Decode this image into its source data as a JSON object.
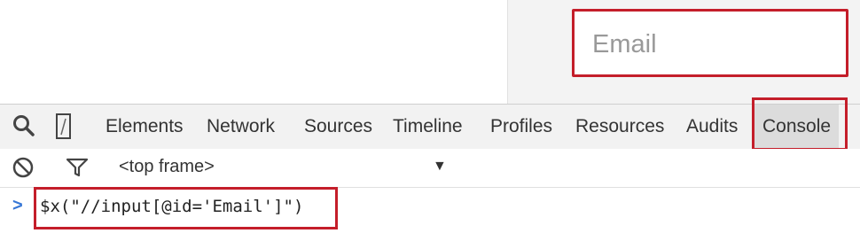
{
  "page": {
    "email_placeholder": "Email"
  },
  "devtools": {
    "toolbar": {
      "icons": [
        "search-icon",
        "device-mode-icon"
      ],
      "tabs": [
        {
          "label": "Elements",
          "active": false
        },
        {
          "label": "Network",
          "active": false
        },
        {
          "label": "Sources",
          "active": false
        },
        {
          "label": "Timeline",
          "active": false
        },
        {
          "label": "Profiles",
          "active": false
        },
        {
          "label": "Resources",
          "active": false
        },
        {
          "label": "Audits",
          "active": false
        },
        {
          "label": "Console",
          "active": true
        }
      ]
    },
    "console": {
      "toolbar_icons": [
        "clear-console-icon",
        "filter-icon"
      ],
      "frame_selector": "<top frame>",
      "prompt_symbol": ">",
      "command": "$x(\"//input[@id='Email']\")"
    }
  },
  "colors": {
    "highlight_border": "#c41e2a",
    "prompt": "#3777d6"
  }
}
